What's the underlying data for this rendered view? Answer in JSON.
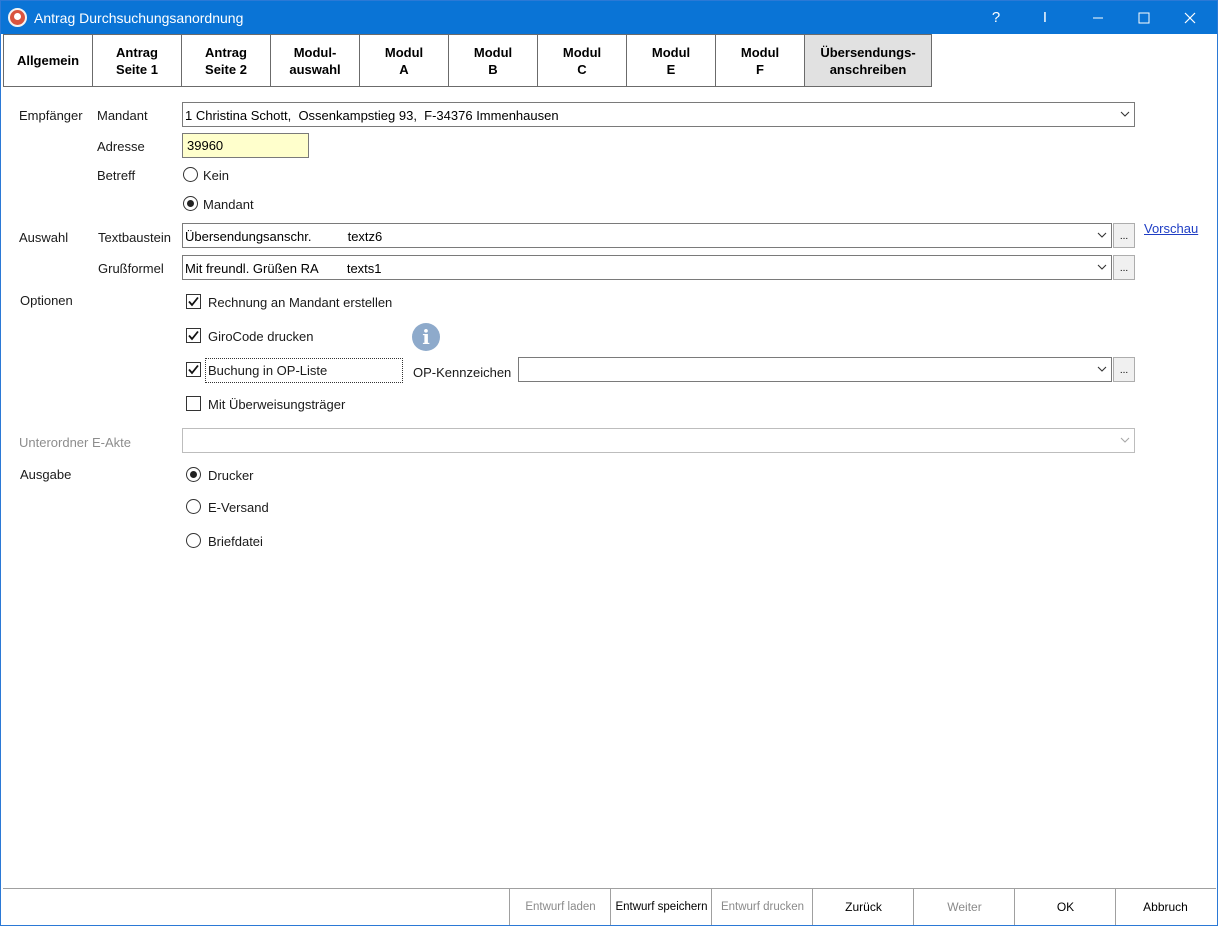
{
  "window": {
    "title": "Antrag Durchsuchungsanordnung",
    "help_label": "?",
    "pin_label": "I",
    "colors": {
      "titlebar": "#0a74d6",
      "input_bg": "#ffffcc",
      "info": "#8eaacb",
      "link": "#1f3ec4"
    }
  },
  "tabs": [
    {
      "label": "Allgemein",
      "active": false
    },
    {
      "label": "Antrag\nSeite 1",
      "active": false
    },
    {
      "label": "Antrag\nSeite 2",
      "active": false
    },
    {
      "label": "Modul-\nauswahl",
      "active": false
    },
    {
      "label": "Modul\nA",
      "active": false
    },
    {
      "label": "Modul\nB",
      "active": false
    },
    {
      "label": "Modul\nC",
      "active": false
    },
    {
      "label": "Modul\nE",
      "active": false
    },
    {
      "label": "Modul\nF",
      "active": false
    },
    {
      "label": "Übersendungs-\nanschreiben",
      "active": true
    }
  ],
  "form": {
    "empfaenger_label": "Empfänger",
    "mandant_label": "Mandant",
    "mandant_value": "1 Christina Schott,  Ossenkampstieg 93,  F-34376 Immenhausen",
    "adresse_label": "Adresse",
    "adresse_value": "39960",
    "betreff_label": "Betreff",
    "betreff_options": [
      {
        "label": "Kein",
        "checked": false
      },
      {
        "label": "Mandant",
        "checked": true
      }
    ],
    "auswahl_label": "Auswahl",
    "textbaustein_label": "Textbaustein",
    "textbaustein_value": "Übersendungsanschr.          textz6",
    "grussformel_label": "Grußformel",
    "grussformel_value": "Mit freundl. Grüßen RA        texts1",
    "vorschau_label": "Vorschau",
    "dots_label": "...",
    "optionen_label": "Optionen",
    "options": [
      {
        "label": "Rechnung an Mandant erstellen",
        "checked": true
      },
      {
        "label": "GiroCode drucken",
        "checked": true
      },
      {
        "label": "Buchung in OP-Liste",
        "checked": true
      },
      {
        "label": "Mit Überweisungsträger",
        "checked": false
      }
    ],
    "info_glyph": "i",
    "op_kennzeichen_label": "OP-Kennzeichen",
    "op_kennzeichen_value": "",
    "unterordner_label": "Unterordner E-Akte",
    "unterordner_value": "",
    "ausgabe_label": "Ausgabe",
    "ausgabe_options": [
      {
        "label": "Drucker",
        "checked": true
      },
      {
        "label": "E-Versand",
        "checked": false
      },
      {
        "label": "Briefdatei",
        "checked": false
      }
    ]
  },
  "footer": {
    "entwurf_laden": "Entwurf laden",
    "entwurf_speichern": "Entwurf speichern",
    "entwurf_drucken": "Entwurf drucken",
    "zurueck": "Zurück",
    "weiter": "Weiter",
    "ok": "OK",
    "abbruch": "Abbruch"
  }
}
